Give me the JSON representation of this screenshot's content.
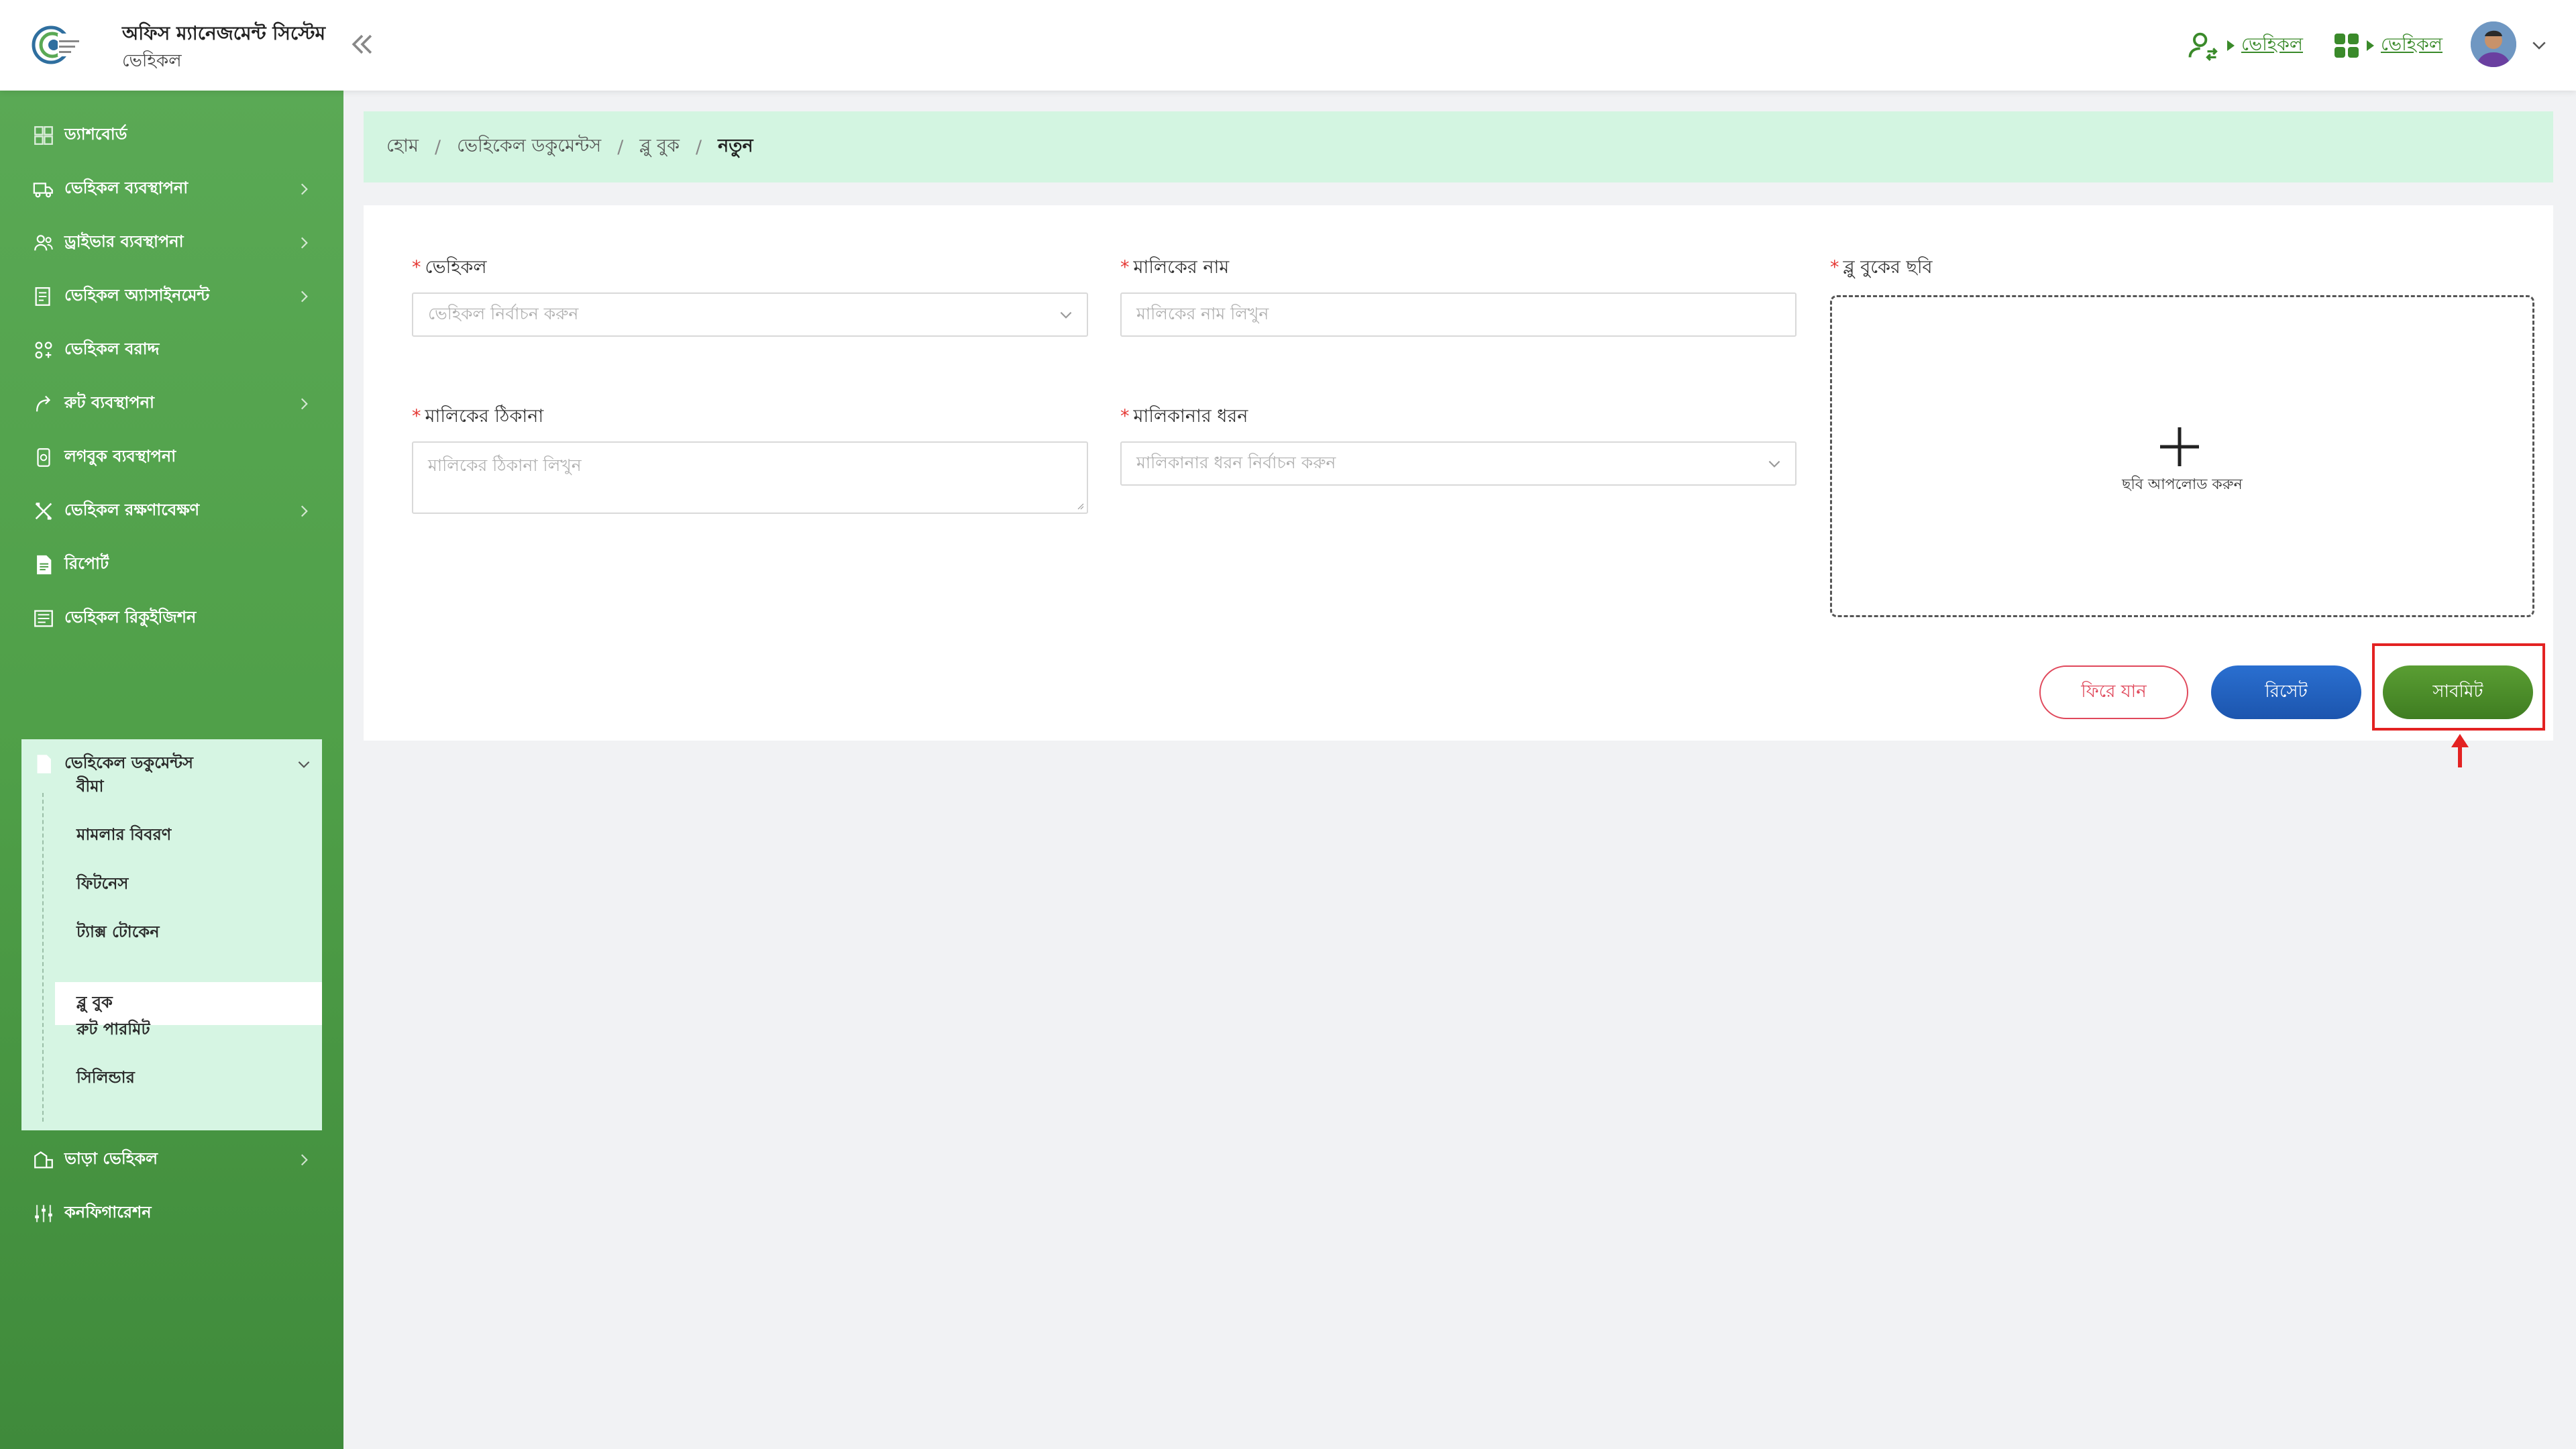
{
  "header": {
    "app_title": "অফিস ম্যানেজমেন্ট সিস্টেম",
    "module": "ভেহিকল",
    "user_link": "ভেহিকল",
    "apps_link": "ভেহিকল"
  },
  "sidebar": {
    "items": [
      {
        "label": "ড্যাশবোর্ড",
        "icon": "dashboard-icon"
      },
      {
        "label": "ভেহিকল ব্যবস্থাপনা",
        "icon": "truck-icon"
      },
      {
        "label": "ড্রাইভার ব্যবস্থাপনা",
        "icon": "users-icon"
      },
      {
        "label": "ভেহিকল অ্যাসাইনমেন্ট",
        "icon": "clipboard-icon"
      },
      {
        "label": "ভেহিকল বরাদ্দ",
        "icon": "group-icon"
      },
      {
        "label": "রুট ব্যবস্থাপনা",
        "icon": "route-icon"
      },
      {
        "label": "লগবুক ব্যবস্থাপনা",
        "icon": "logbook-icon"
      },
      {
        "label": "ভেহিকল রক্ষণাবেক্ষণ",
        "icon": "tools-icon"
      },
      {
        "label": "রিপোর্ট",
        "icon": "report-icon"
      },
      {
        "label": "ভেহিকল রিকুইজিশন",
        "icon": "requisition-icon"
      },
      {
        "label": "ভেহিকেল ডকুমেন্টস",
        "icon": "document-icon"
      },
      {
        "label": "ভাড়া ভেহিকল",
        "icon": "rent-icon"
      },
      {
        "label": "কনফিগারেশন",
        "icon": "settings-sliders-icon"
      }
    ],
    "documents_submenu": [
      "বীমা",
      "মামলার বিবরণ",
      "ফিটনেস",
      "ট্যাক্স টোকেন",
      "ব্লু বুক",
      "রুট পারমিট",
      "সিলিন্ডার"
    ]
  },
  "breadcrumb": {
    "home": "হোম",
    "documents": "ভেহিকেল ডকুমেন্টস",
    "bluebook": "ব্লু বুক",
    "current": "নতুন",
    "separator": "/"
  },
  "form": {
    "required_mark": "*",
    "vehicle": {
      "label": "ভেহিকল",
      "placeholder": "ভেহিকল নির্বাচন করুন"
    },
    "owner_name": {
      "label": "মালিকের নাম",
      "placeholder": "মালিকের নাম লিখুন"
    },
    "owner_address": {
      "label": "মালিকের ঠিকানা",
      "placeholder": "মালিকের ঠিকানা লিখুন"
    },
    "ownership_type": {
      "label": "মালিকানার ধরন",
      "placeholder": "মালিকানার ধরন নির্বাচন করুন"
    },
    "bluebook_image": {
      "label": "ব্লু বুকের ছবি",
      "upload_text": "ছবি আপলোড করুন"
    }
  },
  "buttons": {
    "back": "ফিরে যান",
    "reset": "রিসেট",
    "submit": "সাবমিট"
  },
  "colors": {
    "sidebar": "#4f9f48",
    "submenu_bg": "#d6f5e3",
    "breadcrumb_bg": "#d3f5e1",
    "submit": "#4a8b2a",
    "reset": "#1f5fbf",
    "back": "#e0485b",
    "highlight": "#e32222"
  }
}
